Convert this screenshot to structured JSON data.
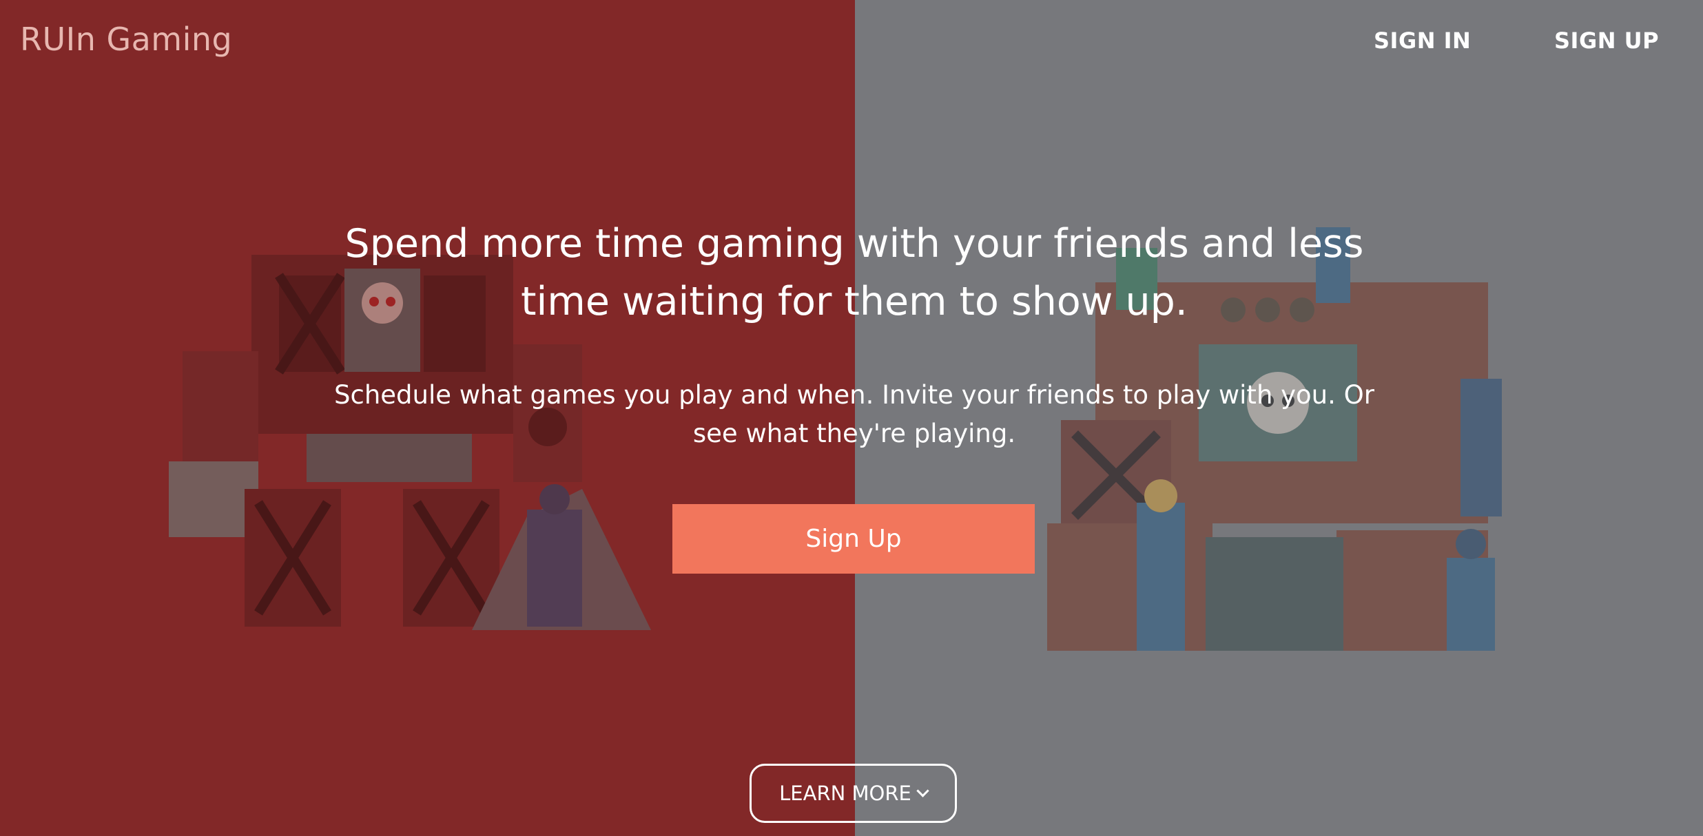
{
  "brand": {
    "name": "RUIn Gaming"
  },
  "nav": {
    "sign_in": "SIGN IN",
    "sign_up": "SIGN UP"
  },
  "hero": {
    "title": "Spend more time gaming with your friends and less time waiting for them to show up.",
    "subtitle": "Schedule what games you play and when. Invite your friends to play with you. Or see what they're playing.",
    "cta_label": "Sign Up",
    "learn_more_label": "LEARN MORE"
  },
  "icons": {
    "learn_more": "chevron-down-icon",
    "left_art": "mech-robot-illustration-icon",
    "right_art": "mech-robot-illustration-icon"
  },
  "colors": {
    "left_panel": "#822828",
    "right_panel": "#77787C",
    "brand_text": "#E7B7B0",
    "cta": "#F2765C",
    "text": "#FFFFFF"
  }
}
